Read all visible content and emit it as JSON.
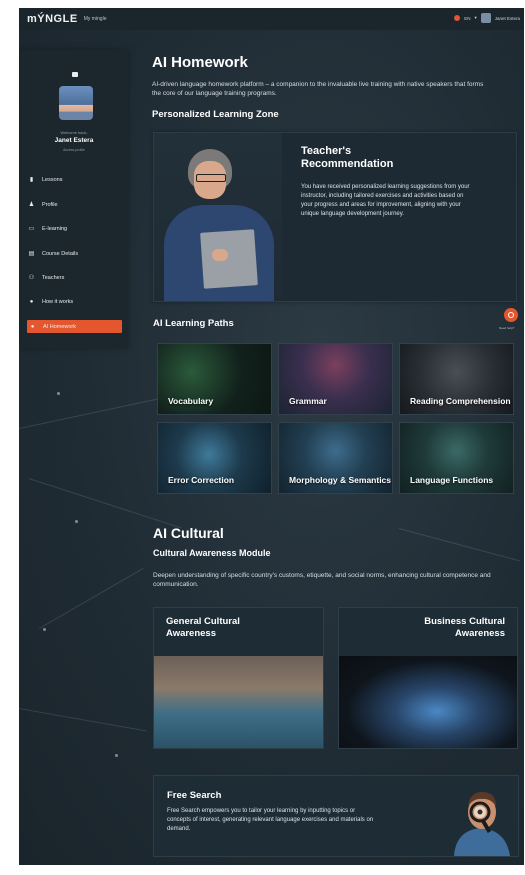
{
  "topbar": {
    "logo": "mÝNGLE",
    "nav_link": "My mingle",
    "language": "EN",
    "user_name": "Janet Estera"
  },
  "sidebar": {
    "welcome": "Welcome back,",
    "name": "Janet Estera",
    "subtitle": "Access profile",
    "items": [
      {
        "label": "Lessons",
        "icon": "book-icon"
      },
      {
        "label": "Profile",
        "icon": "person-icon"
      },
      {
        "label": "E-learning",
        "icon": "laptop-icon"
      },
      {
        "label": "Course Details",
        "icon": "document-icon"
      },
      {
        "label": "Teachers",
        "icon": "group-icon"
      },
      {
        "label": "How it works",
        "icon": "info-icon"
      },
      {
        "label": "AI Homework",
        "icon": "info-icon",
        "active": true
      }
    ]
  },
  "homework": {
    "title": "AI Homework",
    "intro": "AI-driven language homework platform – a companion to the invaluable live training with native speakers that forms the core of our language training programs.",
    "zone_title": "Personalized Learning Zone",
    "recommendation_title": "Teacher's Recommendation",
    "recommendation_text": "You have received personalized learning suggestions from your instructor, including tailored exercises and activities based on your progress and areas for improvement, aligning with your unique language development journey."
  },
  "help": {
    "label": "Need help?"
  },
  "paths": {
    "title": "AI Learning Paths",
    "tiles": [
      {
        "label": "Vocabulary"
      },
      {
        "label": "Grammar"
      },
      {
        "label": "Reading Comprehension"
      },
      {
        "label": "Error Correction"
      },
      {
        "label": "Morphology & Semantics"
      },
      {
        "label": "Language Functions"
      }
    ]
  },
  "cultural": {
    "title": "AI Cultural",
    "subtitle": "Cultural Awareness Module",
    "text": "Deepen understanding of specific country's customs, etiquette, and social norms, enhancing cultural competence and communication.",
    "general": "General Cultural Awareness",
    "business": "Business Cultural Awareness"
  },
  "free_search": {
    "title": "Free Search",
    "text": "Free Search empowers you to tailor your learning by inputting topics or concepts of interest, generating relevant language exercises and materials on demand."
  },
  "colors": {
    "accent": "#e4572e",
    "background": "#233039",
    "card": "#1e2c35"
  }
}
